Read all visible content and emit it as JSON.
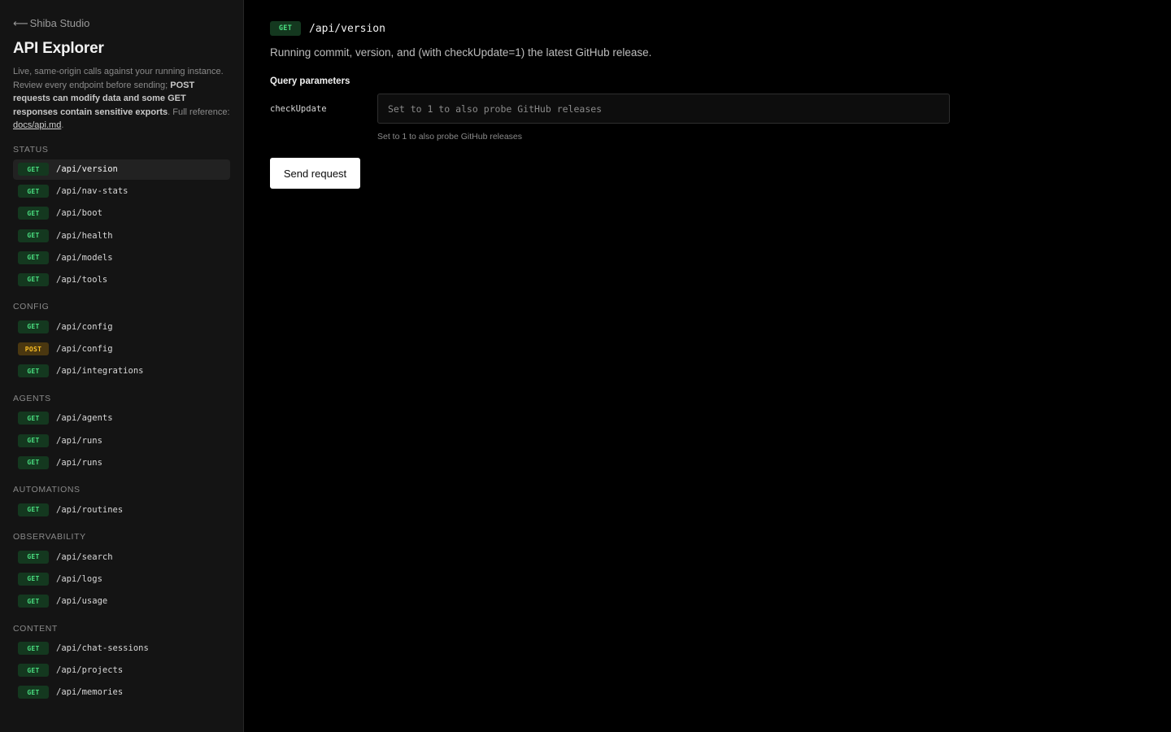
{
  "sidebar": {
    "back_label": "Shiba Studio",
    "title": "API Explorer",
    "description": {
      "part1": "Live, same-origin calls against your running instance. Review every endpoint before sending; ",
      "bold": "POST requests can modify data and some GET responses contain sensitive exports",
      "part2": ". Full reference: ",
      "link": "docs/api.md",
      "part3": "."
    },
    "sections": [
      {
        "title": "STATUS",
        "endpoints": [
          {
            "method": "GET",
            "path": "/api/version",
            "active": true
          },
          {
            "method": "GET",
            "path": "/api/nav-stats"
          },
          {
            "method": "GET",
            "path": "/api/boot"
          },
          {
            "method": "GET",
            "path": "/api/health"
          },
          {
            "method": "GET",
            "path": "/api/models"
          },
          {
            "method": "GET",
            "path": "/api/tools"
          }
        ]
      },
      {
        "title": "CONFIG",
        "endpoints": [
          {
            "method": "GET",
            "path": "/api/config"
          },
          {
            "method": "POST",
            "path": "/api/config"
          },
          {
            "method": "GET",
            "path": "/api/integrations"
          }
        ]
      },
      {
        "title": "AGENTS",
        "endpoints": [
          {
            "method": "GET",
            "path": "/api/agents"
          },
          {
            "method": "GET",
            "path": "/api/runs"
          },
          {
            "method": "GET",
            "path": "/api/runs"
          }
        ]
      },
      {
        "title": "AUTOMATIONS",
        "endpoints": [
          {
            "method": "GET",
            "path": "/api/routines"
          }
        ]
      },
      {
        "title": "OBSERVABILITY",
        "endpoints": [
          {
            "method": "GET",
            "path": "/api/search"
          },
          {
            "method": "GET",
            "path": "/api/logs"
          },
          {
            "method": "GET",
            "path": "/api/usage"
          }
        ]
      },
      {
        "title": "CONTENT",
        "endpoints": [
          {
            "method": "GET",
            "path": "/api/chat-sessions"
          },
          {
            "method": "GET",
            "path": "/api/projects"
          },
          {
            "method": "GET",
            "path": "/api/memories"
          }
        ]
      }
    ]
  },
  "main": {
    "method": "GET",
    "path": "/api/version",
    "description": "Running commit, version, and (with checkUpdate=1) the latest GitHub release.",
    "query_params_title": "Query parameters",
    "params": [
      {
        "name": "checkUpdate",
        "value": "",
        "placeholder": "Set to 1 to also probe GitHub releases",
        "hint": "Set to 1 to also probe GitHub releases"
      }
    ],
    "send_label": "Send request"
  },
  "colors": {
    "get_badge_bg": "#14381f",
    "get_badge_text": "#4ade80",
    "post_badge_bg": "#4a3710",
    "post_badge_text": "#fbbf24",
    "primary_button": "#ffffff"
  },
  "icons": {
    "back": "arrow-left-icon"
  }
}
